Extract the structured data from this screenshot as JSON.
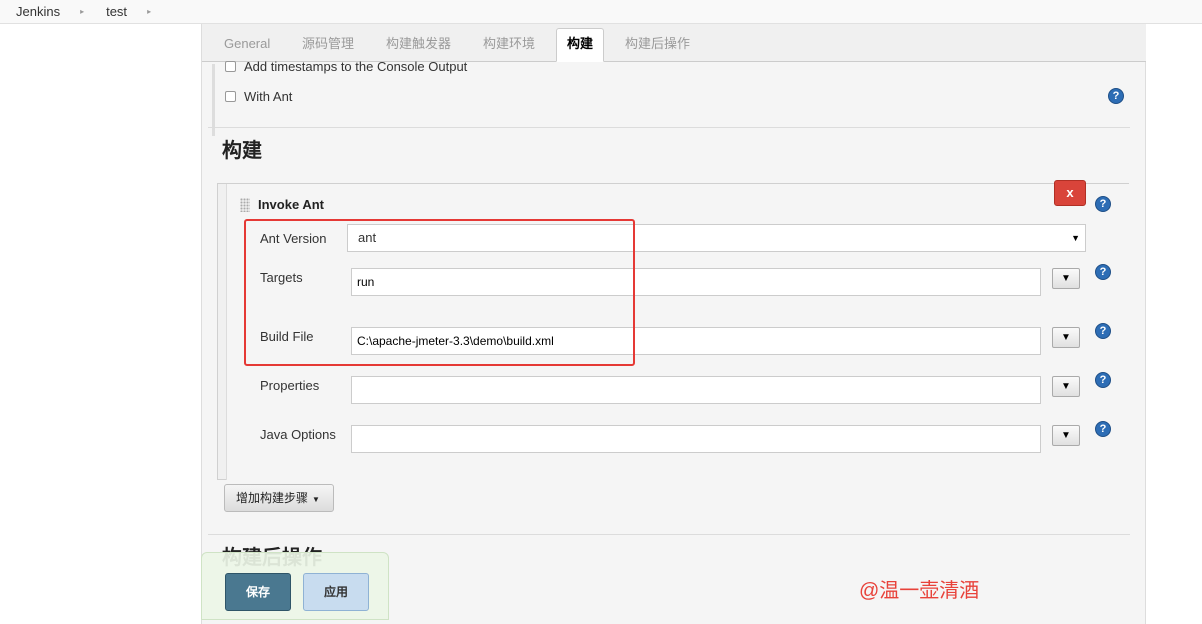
{
  "breadcrumb": {
    "items": [
      "Jenkins",
      "test"
    ],
    "separator": "▸"
  },
  "tabs": [
    {
      "label": "General"
    },
    {
      "label": "源码管理"
    },
    {
      "label": "构建触发器"
    },
    {
      "label": "构建环境"
    },
    {
      "label": "构建",
      "active": true
    },
    {
      "label": "构建后操作"
    }
  ],
  "build_env": {
    "timestamps_label": "Add timestamps to the Console Output",
    "with_ant_label": "With Ant"
  },
  "build": {
    "section_title": "构建",
    "step_title": "Invoke Ant",
    "delete_label": "x",
    "ant_version_label": "Ant Version",
    "ant_version_value": "ant",
    "targets_label": "Targets",
    "targets_value": "run",
    "build_file_label": "Build File",
    "build_file_value": "C:\\apache-jmeter-3.3\\demo\\build.xml",
    "properties_label": "Properties",
    "properties_value": "",
    "java_options_label": "Java Options",
    "java_options_value": "",
    "expand_glyph": "▼",
    "add_step_label": "增加构建步骤"
  },
  "post_build": {
    "section_title": "构建后操作"
  },
  "footer": {
    "save_label": "保存",
    "apply_label": "应用"
  },
  "watermark": "@温一壶清酒",
  "help_glyph": "?",
  "colors": {
    "highlight": "#e53935",
    "save": "#4a7890",
    "apply": "#c8dcef",
    "delete": "#d9443a",
    "watermark": "#e8423a"
  }
}
